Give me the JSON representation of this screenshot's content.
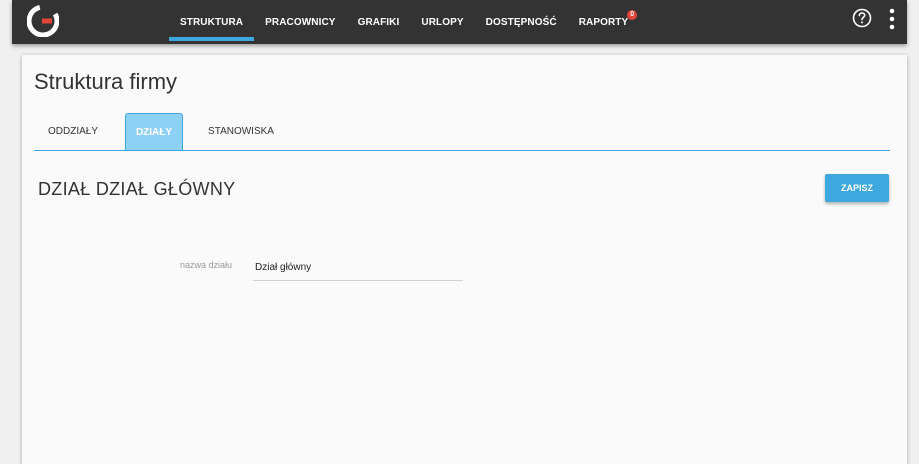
{
  "nav": {
    "items": [
      {
        "label": "STRUKTURA",
        "active": true
      },
      {
        "label": "PRACOWNICY"
      },
      {
        "label": "GRAFIKI"
      },
      {
        "label": "URLOPY"
      },
      {
        "label": "DOSTĘPNOŚĆ"
      },
      {
        "label": "RAPORTY",
        "badge": "0"
      }
    ]
  },
  "page": {
    "title": "Struktura firmy",
    "tabs": [
      {
        "label": "ODDZIAŁY"
      },
      {
        "label": "DZIAŁY",
        "active": true
      },
      {
        "label": "STANOWISKA"
      }
    ],
    "section_title": "DZIAŁ DZIAŁ GŁÓWNY",
    "save_label": "ZAPISZ",
    "form": {
      "name_label": "nazwa działu",
      "name_value": "Dział główny"
    }
  },
  "colors": {
    "topbar": "#333333",
    "accent": "#3ea7dd",
    "active_tab": "#8fd1f5",
    "badge": "#e0453a"
  },
  "icons": {
    "logo": "logo-icon",
    "help": "help-icon",
    "menu": "more-vertical-icon"
  }
}
